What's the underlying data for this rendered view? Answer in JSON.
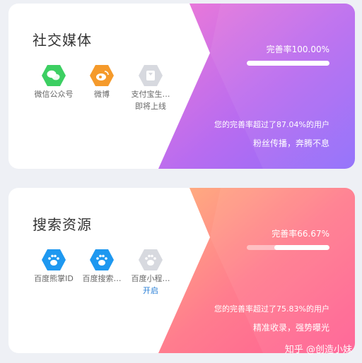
{
  "cards": [
    {
      "title": "社交媒体",
      "icons": [
        {
          "label": "微信公众号",
          "sub": "",
          "icon": "wechat-icon",
          "color": "#3ccf62"
        },
        {
          "label": "微博",
          "sub": "",
          "icon": "weibo-icon",
          "color": "#f59a2b"
        },
        {
          "label": "支付宝生…",
          "sub": "即将上线",
          "icon": "alipay-icon",
          "color": "#d7d9df"
        }
      ],
      "rate_label": "完善率100.00%",
      "rate": 1.0,
      "stat_line": "您的完善率超过了87.04%的用户",
      "slogan": "粉丝传播，奔腾不息",
      "gradient": [
        "#f07ad6",
        "#b86cf0",
        "#8f6dfb"
      ]
    },
    {
      "title": "搜索资源",
      "icons": [
        {
          "label": "百度熊掌ID",
          "sub": "",
          "icon": "baidu-paw-icon",
          "color": "#1e98f0"
        },
        {
          "label": "百度搜索…",
          "sub": "",
          "icon": "baidu-search-icon",
          "color": "#1e98f0"
        },
        {
          "label": "百度小程…",
          "sub": "开启",
          "icon": "baidu-miniapp-icon",
          "color": "#d7d9df"
        }
      ],
      "rate_label": "完善率66.67%",
      "rate": 0.6667,
      "stat_line": "您的完善率超过了75.83%的用户",
      "slogan": "精准收录，强势曝光",
      "gradient": [
        "#ffb27d",
        "#ff7d8e",
        "#ff5f94"
      ]
    }
  ],
  "watermark": "知乎 @创造小妹"
}
